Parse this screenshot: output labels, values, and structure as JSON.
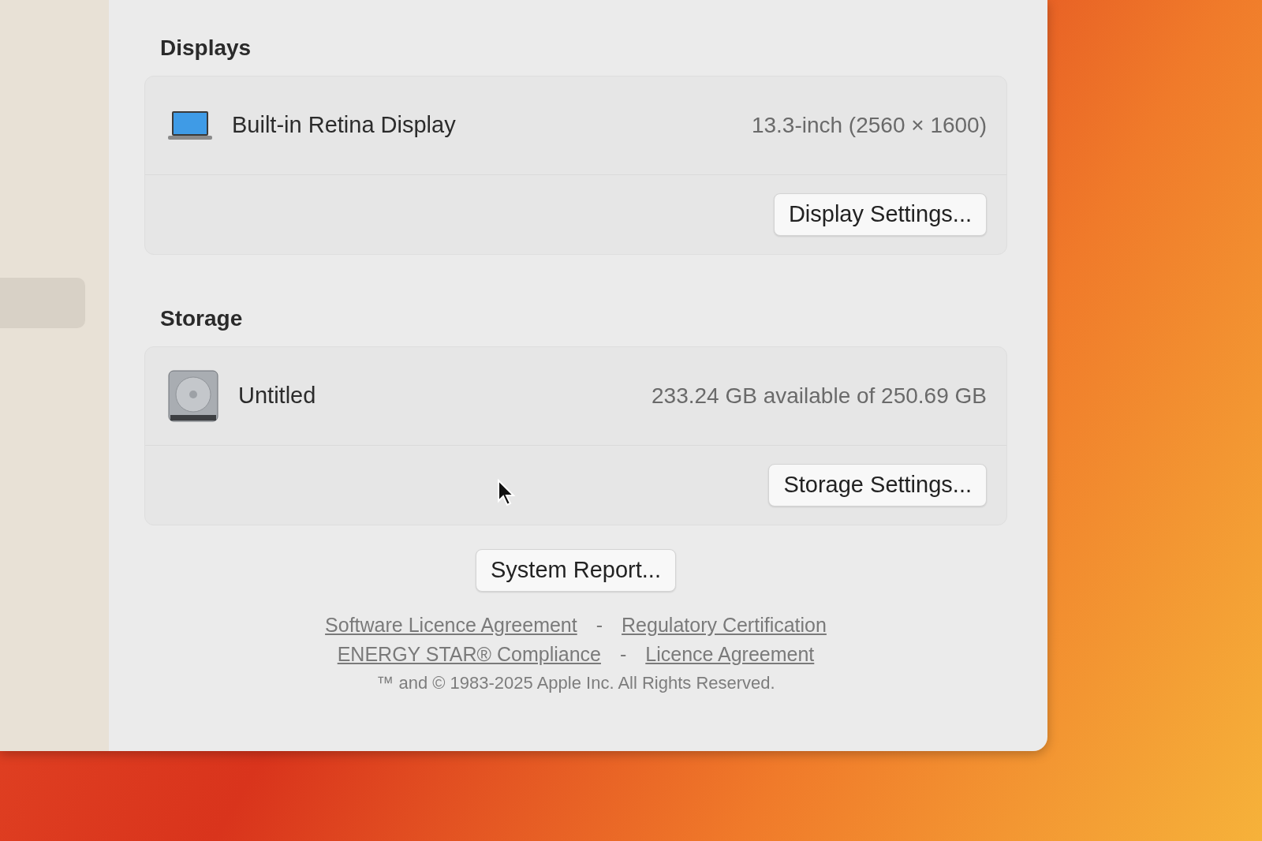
{
  "sidebar": {
    "items": [
      {
        "selected": true
      }
    ]
  },
  "sections": [
    {
      "kind": "display",
      "title": "Displays",
      "name": "Built-in Retina Display",
      "detail": "13.3-inch (2560 × 1600)",
      "button": "Display Settings..."
    },
    {
      "kind": "storage",
      "title": "Storage",
      "name": "Untitled",
      "detail": "233.24 GB available of 250.69 GB",
      "button": "Storage Settings..."
    }
  ],
  "system_report": "System Report...",
  "link_rows": [
    {
      "links": [
        "Software Licence Agreement",
        "Regulatory Certification"
      ],
      "separator": "-"
    },
    {
      "links": [
        "ENERGY STAR® Compliance",
        "Licence Agreement"
      ],
      "separator": "-"
    }
  ],
  "copyright": "™ and © 1983-2025 Apple Inc. All Rights Reserved."
}
